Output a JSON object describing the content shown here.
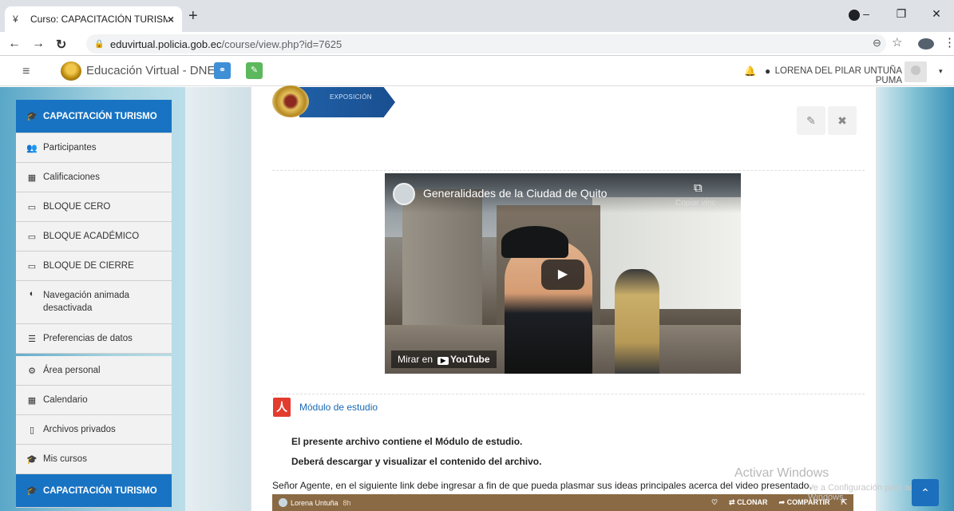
{
  "browser": {
    "tab_title": "Curso: CAPACITACIÓN TURISMO",
    "tab_close": "×",
    "new_tab": "+",
    "url_host": "eduvirtual.policia.gob.ec",
    "url_path": "/course/view.php?id=7625",
    "win_min": "–",
    "win_max": "❐",
    "win_close": "✕"
  },
  "navbar": {
    "site_name": "Educación Virtual - DNE",
    "user_name": "LORENA DEL PILAR UNTUÑA PUMA"
  },
  "sidebar": {
    "course_header": "CAPACITACIÓN TURISMO",
    "items": [
      {
        "label": "Participantes",
        "icon": "users-icon"
      },
      {
        "label": "Calificaciones",
        "icon": "table-icon"
      },
      {
        "label": "BLOQUE CERO",
        "icon": "folder-icon"
      },
      {
        "label": "BLOQUE ACADÉMICO",
        "icon": "folder-icon"
      },
      {
        "label": "BLOQUE DE CIERRE",
        "icon": "folder-icon"
      },
      {
        "label": "Navegación animada desactivada",
        "icon": "toggle-icon"
      },
      {
        "label": "Preferencias de datos",
        "icon": "database-icon"
      }
    ],
    "items2": [
      {
        "label": "Área personal",
        "icon": "dashboard-icon"
      },
      {
        "label": "Calendario",
        "icon": "calendar-icon"
      },
      {
        "label": "Archivos privados",
        "icon": "file-icon"
      },
      {
        "label": "Mis cursos",
        "icon": "graduation-cap-icon"
      }
    ],
    "footer_course": "CAPACITACIÓN TURISMO"
  },
  "main": {
    "banner_label": "EXPOSICIÓN",
    "video": {
      "title": "Generalidades de la Ciudad de Quito",
      "copy_label": "Copiar vínc",
      "watch_on": "Mirar en",
      "youtube": "YouTube"
    },
    "resource_link": "Módulo de estudio",
    "desc_line1": "El presente archivo contiene el Módulo de estudio.",
    "desc_line2": "Deberá descargar y visualizar el contenido del archivo.",
    "instruction": "Señor Agente, en el siguiente link debe ingresar a fin de que pueda plasmar sus ideas principales acerca del video presentado.",
    "padlet": {
      "author": "Lorena Untuña",
      "time": "8h",
      "clone": "CLONAR",
      "share": "COMPARTIR"
    }
  },
  "watermark": {
    "line1": "Activar Windows",
    "line2": "Ve a Configuración para activar Windows."
  }
}
